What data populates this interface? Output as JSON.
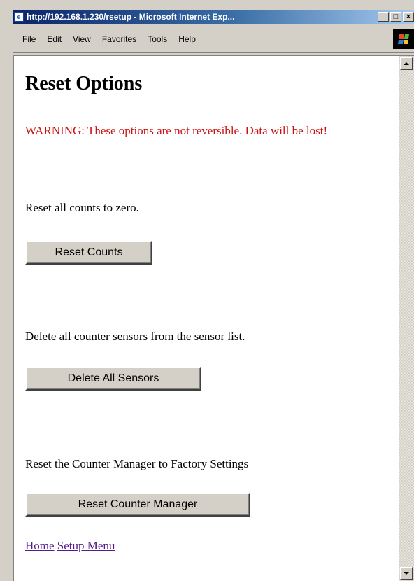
{
  "window": {
    "title": "http://192.168.1.230/rsetup - Microsoft Internet Exp...",
    "minimize_label": "_",
    "maximize_label": "□",
    "close_label": "×"
  },
  "menu": {
    "items": [
      {
        "label": "File"
      },
      {
        "label": "Edit"
      },
      {
        "label": "View"
      },
      {
        "label": "Favorites"
      },
      {
        "label": "Tools"
      },
      {
        "label": "Help"
      }
    ]
  },
  "page": {
    "heading": "Reset Options",
    "warning": "WARNING: These options are not reversible. Data will be lost!",
    "sections": [
      {
        "description": "Reset all counts to zero.",
        "button_label": "Reset Counts"
      },
      {
        "description": "Delete all counter sensors from the sensor list.",
        "button_label": "Delete All Sensors"
      },
      {
        "description": "Reset the Counter Manager to Factory Settings",
        "button_label": "Reset Counter Manager"
      }
    ],
    "links": [
      {
        "label": "Home"
      },
      {
        "label": "Setup Menu"
      }
    ]
  },
  "colors": {
    "warning": "#cc1111",
    "visited_link": "#551a8b",
    "title_bar": "#0a246a"
  },
  "icons": {
    "app_icon": "internet-explorer-icon",
    "throbber": "windows-logo-icon",
    "scroll_up": "scroll-up-arrow-icon",
    "scroll_down": "scroll-down-arrow-icon"
  }
}
